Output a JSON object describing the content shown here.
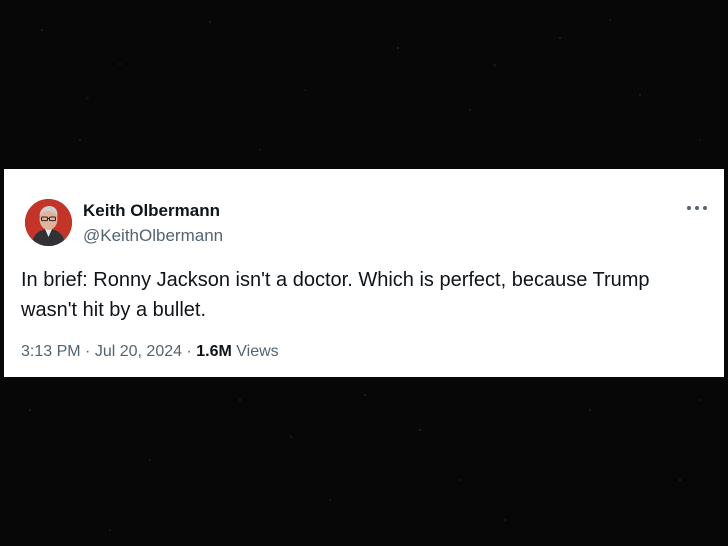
{
  "tweet": {
    "author": {
      "name": "Keith Olbermann",
      "handle": "@KeithOlbermann"
    },
    "text": "In brief: Ronny Jackson isn't a doctor. Which is perfect, because Trump wasn't hit by a bullet.",
    "time": "3:13 PM",
    "separator": "·",
    "date": "Jul 20, 2024",
    "views_count": "1.6M",
    "views_label": "Views"
  },
  "icons": {
    "more": "more-horizontal-icon"
  },
  "colors": {
    "background": "#070707",
    "card": "#ffffff",
    "text_primary": "#0f1419",
    "text_secondary": "#536471",
    "avatar_bg": "#c43427"
  }
}
